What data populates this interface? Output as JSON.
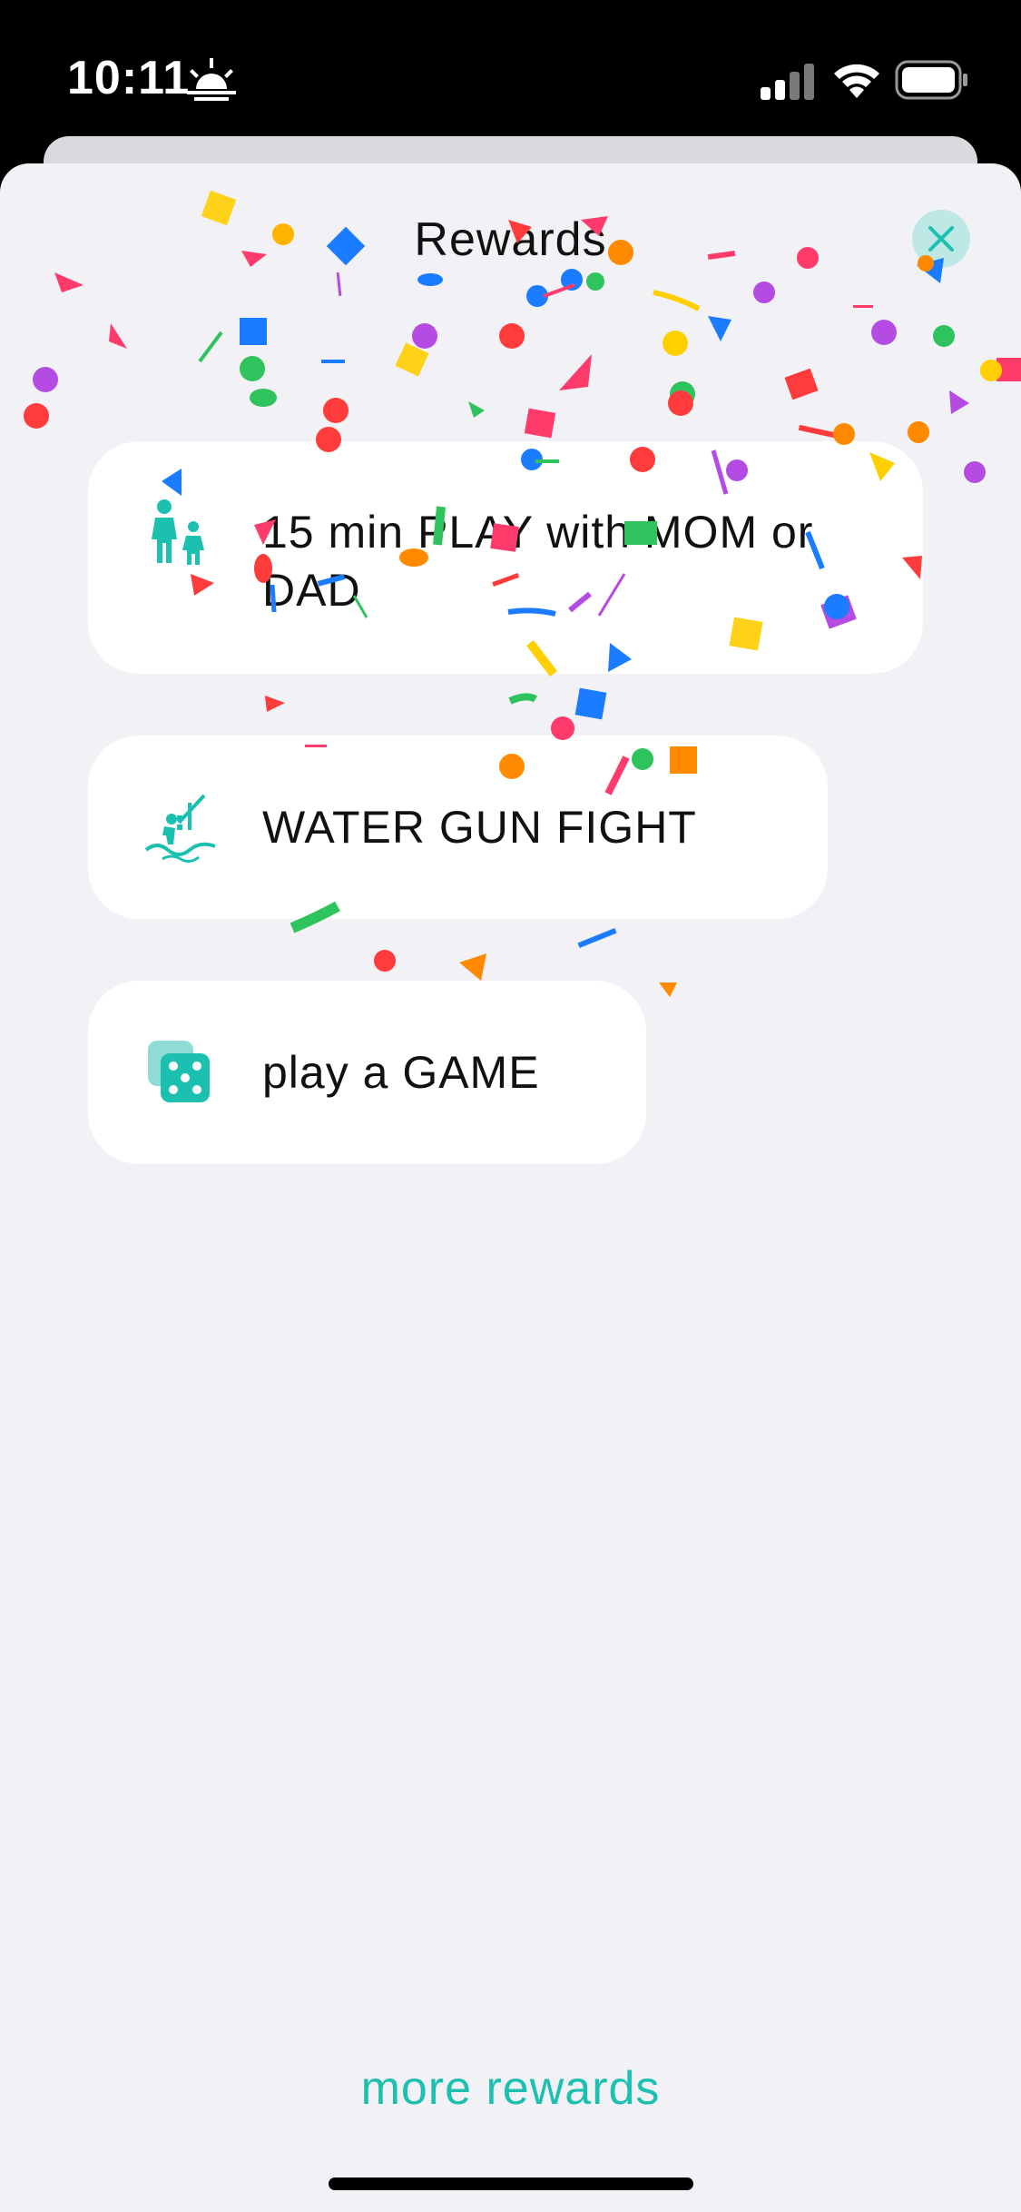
{
  "status_bar": {
    "time": "10:11",
    "icons": [
      "sunrise-icon",
      "cellular-signal-icon",
      "wifi-icon",
      "battery-icon"
    ]
  },
  "header": {
    "title": "Rewards",
    "close_icon": "close-icon"
  },
  "rewards": [
    {
      "label": "15 min PLAY with MOM or DAD",
      "icon": "parent-child-icon"
    },
    {
      "label": "WATER GUN FIGHT",
      "icon": "water-slide-icon"
    },
    {
      "label": "play a GAME",
      "icon": "dice-icon"
    }
  ],
  "footer": {
    "more_rewards": "more rewards"
  },
  "colors": {
    "accent": "#1cc0b0",
    "sheet_background": "#f2f1f6",
    "card_background": "#ffffff"
  },
  "decoration": "confetti"
}
